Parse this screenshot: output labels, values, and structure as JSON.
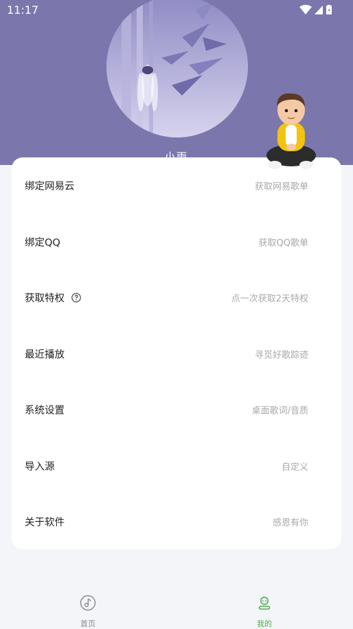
{
  "status_bar": {
    "time": "11:17",
    "icons": [
      "wifi-icon",
      "signal-icon",
      "battery-icon"
    ]
  },
  "profile": {
    "nickname": "小雨",
    "header_color": "#7b77ad"
  },
  "menu": [
    {
      "label": "绑定网易云",
      "hint": "获取网易歌单"
    },
    {
      "label": "绑定QQ",
      "hint": "获取QQ歌单"
    },
    {
      "label": "获取特权",
      "hint": "点一次获取2天特权",
      "icon": "help-circle-icon"
    },
    {
      "label": "最近播放",
      "hint": "寻觅好歌踪迹"
    },
    {
      "label": "系统设置",
      "hint": "桌面歌词/音质"
    },
    {
      "label": "导入源",
      "hint": "自定义"
    },
    {
      "label": "关于软件",
      "hint": "感恩有你"
    }
  ],
  "bottom_nav": [
    {
      "label": "首页",
      "icon": "music-disc-icon",
      "active": false
    },
    {
      "label": "我的",
      "icon": "profile-icon",
      "active": true
    }
  ],
  "colors": {
    "accent": "#4cae4c",
    "inactive": "#888888",
    "hint": "#a8a8a8"
  }
}
